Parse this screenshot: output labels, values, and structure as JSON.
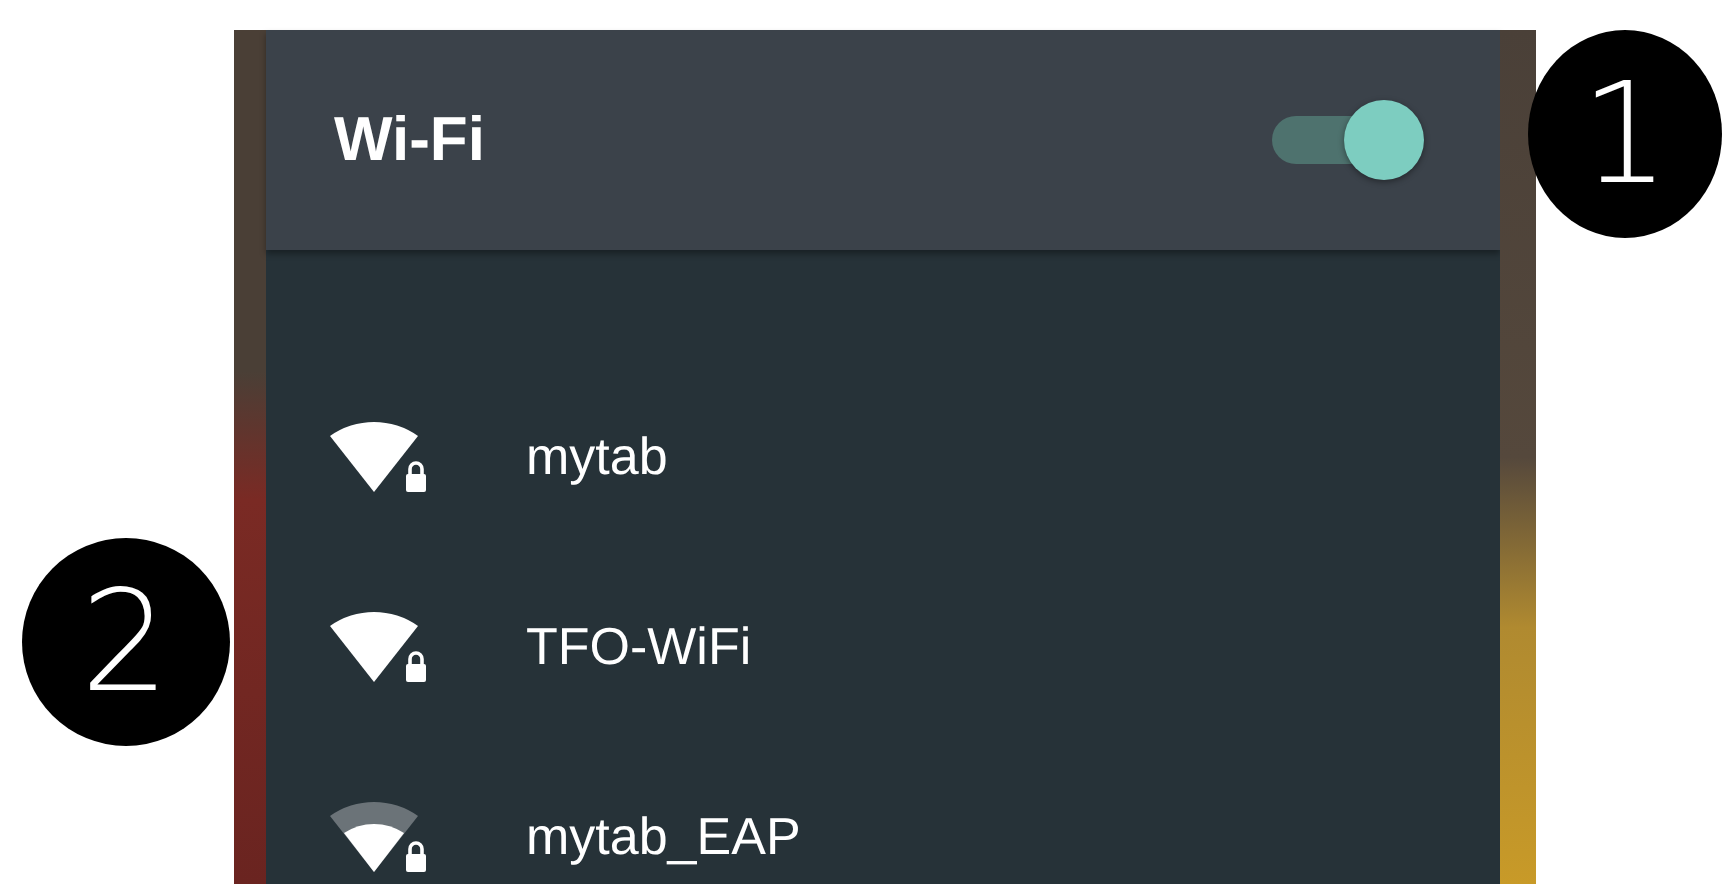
{
  "callouts": [
    "1",
    "2"
  ],
  "header": {
    "title": "Wi-Fi",
    "on": true
  },
  "networks": [
    {
      "name": "mytab",
      "kind": "full",
      "secured": true
    },
    {
      "name": "TFO-WiFi",
      "kind": "full",
      "secured": true
    },
    {
      "name": "mytab_EAP",
      "kind": "weak",
      "secured": true
    }
  ]
}
